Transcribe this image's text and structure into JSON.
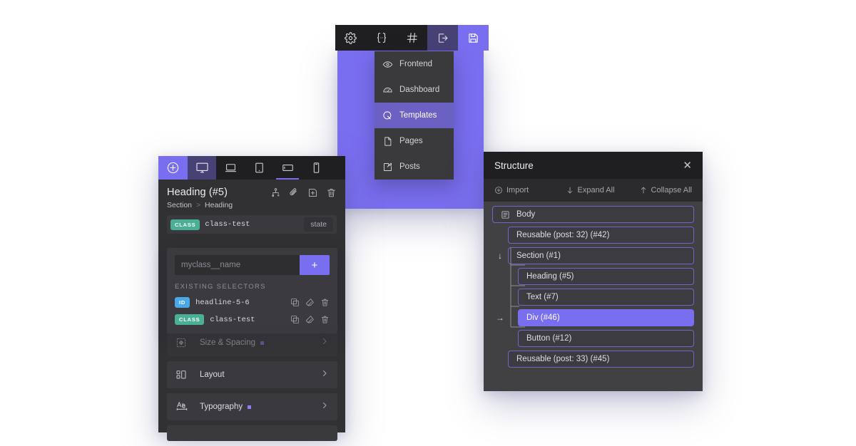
{
  "colors": {
    "accent": "#7a6ef0",
    "accent_muted": "#474276",
    "panel_dark": "#1f1f22",
    "panel_mid": "#313134",
    "panel_light": "#414144",
    "badge_class": "#49b095",
    "badge_id": "#4aa8e8",
    "node_border": "#6f66c9"
  },
  "toolbar": {
    "buttons": [
      {
        "name": "settings-icon",
        "label": "Settings",
        "state": "default"
      },
      {
        "name": "code-icon",
        "label": "Code",
        "state": "default"
      },
      {
        "name": "grid-icon",
        "label": "Grid",
        "state": "default"
      },
      {
        "name": "export-icon",
        "label": "Export",
        "state": "semi"
      },
      {
        "name": "save-icon",
        "label": "Save",
        "state": "active"
      }
    ]
  },
  "template_menu": {
    "items": [
      {
        "label": "Frontend",
        "icon": "eye-icon",
        "selected": false
      },
      {
        "label": "Dashboard",
        "icon": "dashboard-icon",
        "selected": false
      },
      {
        "label": "Templates",
        "icon": "templates-icon",
        "selected": true
      },
      {
        "label": "Pages",
        "icon": "page-icon",
        "selected": false
      },
      {
        "label": "Posts",
        "icon": "post-edit-icon",
        "selected": false
      }
    ]
  },
  "left_panel": {
    "devices": [
      {
        "name": "add-element-button",
        "icon": "plus-circle-icon",
        "style": "add"
      },
      {
        "name": "device-desktop",
        "icon": "monitor-icon",
        "style": "on"
      },
      {
        "name": "device-laptop",
        "icon": "laptop-icon",
        "style": "off"
      },
      {
        "name": "device-tablet-portrait",
        "icon": "tablet-icon",
        "style": "off"
      },
      {
        "name": "device-tablet-landscape",
        "icon": "tablet-landscape-icon",
        "style": "underline"
      },
      {
        "name": "device-mobile",
        "icon": "mobile-icon",
        "style": "off"
      }
    ],
    "element_title": "Heading (#5)",
    "title_icons": [
      {
        "name": "structure-icon",
        "label": "Structure"
      },
      {
        "name": "link-icon",
        "label": "Link"
      },
      {
        "name": "duplicate-icon",
        "label": "Duplicate"
      },
      {
        "name": "trash-icon",
        "label": "Delete"
      }
    ],
    "breadcrumb": {
      "parent": "Section",
      "separator": ">",
      "current": "Heading"
    },
    "active_selector": {
      "badge": "CLASS",
      "name": "class-test",
      "state_label": "state"
    },
    "selectors_popover": {
      "new_selector_placeholder": "myclass__name",
      "new_selector_value": "",
      "add_label": "+",
      "existing_label": "EXISTING SELECTORS",
      "rows": [
        {
          "badge": "ID",
          "badge_type": "id",
          "name": "headline-5-6"
        },
        {
          "badge": "CLASS",
          "badge_type": "class",
          "name": "class-test"
        }
      ],
      "row_icons": [
        {
          "name": "copy-icon",
          "label": "Copy"
        },
        {
          "name": "eraser-icon",
          "label": "Clear"
        },
        {
          "name": "trash-icon",
          "label": "Delete"
        }
      ]
    },
    "accordions": [
      {
        "label": "Size & Spacing",
        "icon": "move-arrows-icon",
        "has_dot": true,
        "dim": true
      },
      {
        "label": "Layout",
        "icon": "layout-icon",
        "has_dot": false,
        "dim": false
      },
      {
        "label": "Typography",
        "icon": "typography-icon",
        "has_dot": true,
        "dim": false
      },
      {
        "label": "",
        "icon": "",
        "has_dot": false,
        "dim": false
      }
    ]
  },
  "structure_panel": {
    "title": "Structure",
    "close_label": "✕",
    "tools": [
      {
        "label": "Import",
        "icon": "plus-circle-icon"
      },
      {
        "label": "Expand All",
        "icon": "arrow-down-icon"
      },
      {
        "label": "Collapse All",
        "icon": "arrow-up-icon"
      }
    ],
    "tree": [
      {
        "label": "Body",
        "indent": 0,
        "marker": "",
        "selected": false,
        "root": true,
        "icon": "body-icon"
      },
      {
        "label": "Reusable (post: 32) (#42)",
        "indent": 1,
        "marker": "",
        "selected": false
      },
      {
        "label": "Section (#1)",
        "indent": 1,
        "marker": "↓",
        "selected": false
      },
      {
        "label": "Heading (#5)",
        "indent": 2,
        "marker": "",
        "selected": false
      },
      {
        "label": "Text (#7)",
        "indent": 2,
        "marker": "",
        "selected": false
      },
      {
        "label": "Div (#46)",
        "indent": 2,
        "marker": "→",
        "selected": true
      },
      {
        "label": "Button (#12)",
        "indent": 2,
        "marker": "",
        "selected": false
      },
      {
        "label": "Reusable (post: 33) (#45)",
        "indent": 1,
        "marker": "",
        "selected": false
      }
    ]
  }
}
